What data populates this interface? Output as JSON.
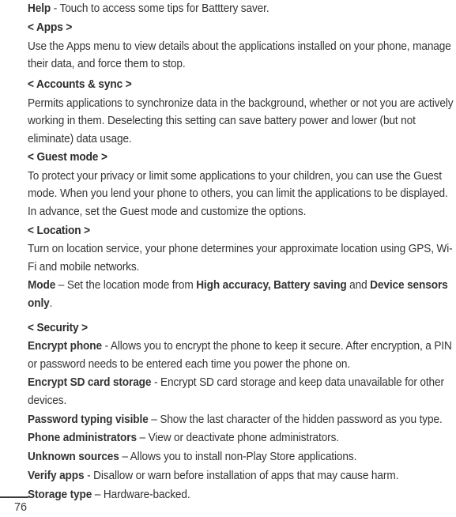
{
  "page": {
    "number": "76",
    "text_color": "#333333",
    "background_color": "#ffffff"
  },
  "blocks": [
    {
      "id": "help-entry",
      "type": "definition",
      "term": "Help",
      "separator": " - ",
      "description": "Touch to access some tips for Batttery saver."
    },
    {
      "id": "apps-heading",
      "type": "heading",
      "text": "< Apps >"
    },
    {
      "id": "apps-body",
      "type": "paragraph",
      "text": "Use the Apps menu to view details about the applications installed on your phone, manage their data, and force them to stop."
    },
    {
      "id": "accounts-sync-heading",
      "type": "heading",
      "text": "< Accounts & sync >"
    },
    {
      "id": "accounts-sync-body",
      "type": "paragraph",
      "text": "Permits applications to synchronize data in the background, whether or not you are actively working in them. Deselecting this setting can save battery power and lower (but not eliminate) data usage."
    },
    {
      "id": "guest-mode-heading",
      "type": "heading",
      "text": "< Guest mode >"
    },
    {
      "id": "guest-mode-body",
      "type": "paragraph",
      "text": "To protect your privacy or limit some applications to your children, you can use the Guest mode. When you lend your phone to others, you can limit the applications to be displayed. In advance, set the Guest mode and customize the options."
    },
    {
      "id": "location-heading",
      "type": "heading",
      "text": "< Location >"
    },
    {
      "id": "location-body",
      "type": "paragraph",
      "text": "Turn on location service, your phone determines your approximate location using GPS, Wi-Fi and mobile networks."
    },
    {
      "id": "mode-entry",
      "type": "rich",
      "runs": [
        {
          "text": "Mode",
          "bold": true
        },
        {
          "text": " – Set the location mode from ",
          "bold": false
        },
        {
          "text": "High accuracy, Battery saving",
          "bold": true
        },
        {
          "text": " and ",
          "bold": false
        },
        {
          "text": "Device sensors only",
          "bold": true
        },
        {
          "text": ".",
          "bold": false
        }
      ]
    },
    {
      "id": "security-heading",
      "type": "heading",
      "text": "< Security >"
    },
    {
      "id": "encrypt-phone-entry",
      "type": "definition",
      "term": "Encrypt phone",
      "separator": " - ",
      "description": "Allows you to encrypt the phone to keep it secure. After encryption, a PIN or password needs to be entered each time you power the phone on."
    },
    {
      "id": "encrypt-sd-entry",
      "type": "definition",
      "term": "Encrypt SD card storage",
      "separator": " - ",
      "description": "Encrypt SD card storage and keep data unavailable for other devices."
    },
    {
      "id": "password-typing-entry",
      "type": "definition",
      "term": "Password typing visible",
      "separator": " – ",
      "description": "Show the last character of the hidden password as you type."
    },
    {
      "id": "phone-administrators-entry",
      "type": "definition",
      "term": "Phone administrators",
      "separator": " – ",
      "description": "View or deactivate phone administrators."
    },
    {
      "id": "unknown-sources-entry",
      "type": "definition",
      "term": "Unknown sources",
      "separator": " – ",
      "description": "Allows you to install non-Play Store applications."
    },
    {
      "id": "verify-apps-entry",
      "type": "definition",
      "term": "Verify apps",
      "separator": " - ",
      "description": "Disallow or warn before installation of apps that may cause harm."
    },
    {
      "id": "storage-type-entry",
      "type": "definition",
      "term": "Storage type",
      "separator": " – ",
      "description": "Hardware-backed."
    }
  ]
}
